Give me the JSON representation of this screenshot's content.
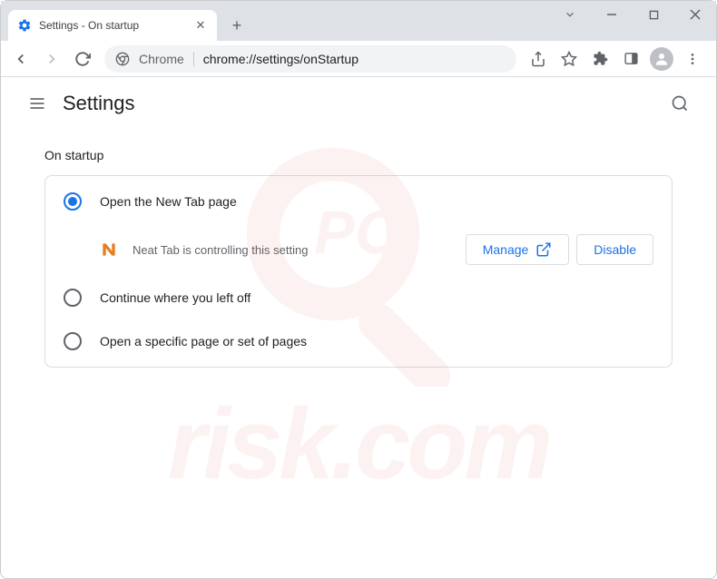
{
  "window": {
    "tab_title": "Settings - On startup"
  },
  "toolbar": {
    "chrome_label": "Chrome",
    "url": "chrome://settings/onStartup"
  },
  "header": {
    "title": "Settings"
  },
  "section": {
    "title": "On startup",
    "options": [
      {
        "label": "Open the New Tab page",
        "selected": true
      },
      {
        "label": "Continue where you left off",
        "selected": false
      },
      {
        "label": "Open a specific page or set of pages",
        "selected": false
      }
    ],
    "controlled": {
      "extension_name": "Neat Tab",
      "message": "Neat Tab is controlling this setting",
      "manage_label": "Manage",
      "disable_label": "Disable"
    }
  },
  "watermark": {
    "text": "risk.com"
  }
}
